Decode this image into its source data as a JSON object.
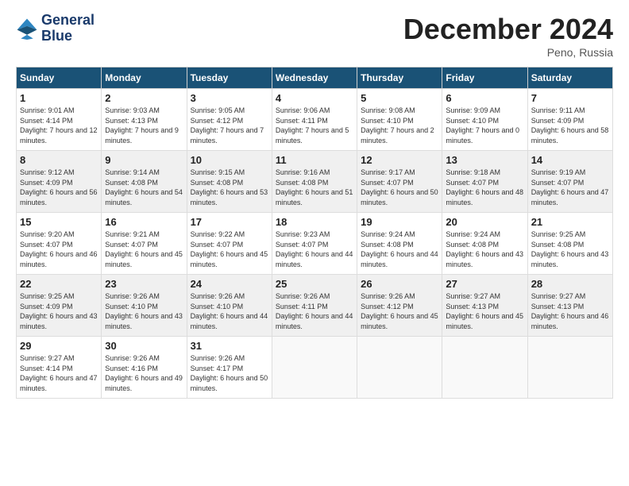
{
  "header": {
    "logo_line1": "General",
    "logo_line2": "Blue",
    "title": "December 2024",
    "location": "Peno, Russia"
  },
  "columns": [
    "Sunday",
    "Monday",
    "Tuesday",
    "Wednesday",
    "Thursday",
    "Friday",
    "Saturday"
  ],
  "weeks": [
    [
      {
        "day": "1",
        "sunrise": "Sunrise: 9:01 AM",
        "sunset": "Sunset: 4:14 PM",
        "daylight": "Daylight: 7 hours and 12 minutes."
      },
      {
        "day": "2",
        "sunrise": "Sunrise: 9:03 AM",
        "sunset": "Sunset: 4:13 PM",
        "daylight": "Daylight: 7 hours and 9 minutes."
      },
      {
        "day": "3",
        "sunrise": "Sunrise: 9:05 AM",
        "sunset": "Sunset: 4:12 PM",
        "daylight": "Daylight: 7 hours and 7 minutes."
      },
      {
        "day": "4",
        "sunrise": "Sunrise: 9:06 AM",
        "sunset": "Sunset: 4:11 PM",
        "daylight": "Daylight: 7 hours and 5 minutes."
      },
      {
        "day": "5",
        "sunrise": "Sunrise: 9:08 AM",
        "sunset": "Sunset: 4:10 PM",
        "daylight": "Daylight: 7 hours and 2 minutes."
      },
      {
        "day": "6",
        "sunrise": "Sunrise: 9:09 AM",
        "sunset": "Sunset: 4:10 PM",
        "daylight": "Daylight: 7 hours and 0 minutes."
      },
      {
        "day": "7",
        "sunrise": "Sunrise: 9:11 AM",
        "sunset": "Sunset: 4:09 PM",
        "daylight": "Daylight: 6 hours and 58 minutes."
      }
    ],
    [
      {
        "day": "8",
        "sunrise": "Sunrise: 9:12 AM",
        "sunset": "Sunset: 4:09 PM",
        "daylight": "Daylight: 6 hours and 56 minutes."
      },
      {
        "day": "9",
        "sunrise": "Sunrise: 9:14 AM",
        "sunset": "Sunset: 4:08 PM",
        "daylight": "Daylight: 6 hours and 54 minutes."
      },
      {
        "day": "10",
        "sunrise": "Sunrise: 9:15 AM",
        "sunset": "Sunset: 4:08 PM",
        "daylight": "Daylight: 6 hours and 53 minutes."
      },
      {
        "day": "11",
        "sunrise": "Sunrise: 9:16 AM",
        "sunset": "Sunset: 4:08 PM",
        "daylight": "Daylight: 6 hours and 51 minutes."
      },
      {
        "day": "12",
        "sunrise": "Sunrise: 9:17 AM",
        "sunset": "Sunset: 4:07 PM",
        "daylight": "Daylight: 6 hours and 50 minutes."
      },
      {
        "day": "13",
        "sunrise": "Sunrise: 9:18 AM",
        "sunset": "Sunset: 4:07 PM",
        "daylight": "Daylight: 6 hours and 48 minutes."
      },
      {
        "day": "14",
        "sunrise": "Sunrise: 9:19 AM",
        "sunset": "Sunset: 4:07 PM",
        "daylight": "Daylight: 6 hours and 47 minutes."
      }
    ],
    [
      {
        "day": "15",
        "sunrise": "Sunrise: 9:20 AM",
        "sunset": "Sunset: 4:07 PM",
        "daylight": "Daylight: 6 hours and 46 minutes."
      },
      {
        "day": "16",
        "sunrise": "Sunrise: 9:21 AM",
        "sunset": "Sunset: 4:07 PM",
        "daylight": "Daylight: 6 hours and 45 minutes."
      },
      {
        "day": "17",
        "sunrise": "Sunrise: 9:22 AM",
        "sunset": "Sunset: 4:07 PM",
        "daylight": "Daylight: 6 hours and 45 minutes."
      },
      {
        "day": "18",
        "sunrise": "Sunrise: 9:23 AM",
        "sunset": "Sunset: 4:07 PM",
        "daylight": "Daylight: 6 hours and 44 minutes."
      },
      {
        "day": "19",
        "sunrise": "Sunrise: 9:24 AM",
        "sunset": "Sunset: 4:08 PM",
        "daylight": "Daylight: 6 hours and 44 minutes."
      },
      {
        "day": "20",
        "sunrise": "Sunrise: 9:24 AM",
        "sunset": "Sunset: 4:08 PM",
        "daylight": "Daylight: 6 hours and 43 minutes."
      },
      {
        "day": "21",
        "sunrise": "Sunrise: 9:25 AM",
        "sunset": "Sunset: 4:08 PM",
        "daylight": "Daylight: 6 hours and 43 minutes."
      }
    ],
    [
      {
        "day": "22",
        "sunrise": "Sunrise: 9:25 AM",
        "sunset": "Sunset: 4:09 PM",
        "daylight": "Daylight: 6 hours and 43 minutes."
      },
      {
        "day": "23",
        "sunrise": "Sunrise: 9:26 AM",
        "sunset": "Sunset: 4:10 PM",
        "daylight": "Daylight: 6 hours and 43 minutes."
      },
      {
        "day": "24",
        "sunrise": "Sunrise: 9:26 AM",
        "sunset": "Sunset: 4:10 PM",
        "daylight": "Daylight: 6 hours and 44 minutes."
      },
      {
        "day": "25",
        "sunrise": "Sunrise: 9:26 AM",
        "sunset": "Sunset: 4:11 PM",
        "daylight": "Daylight: 6 hours and 44 minutes."
      },
      {
        "day": "26",
        "sunrise": "Sunrise: 9:26 AM",
        "sunset": "Sunset: 4:12 PM",
        "daylight": "Daylight: 6 hours and 45 minutes."
      },
      {
        "day": "27",
        "sunrise": "Sunrise: 9:27 AM",
        "sunset": "Sunset: 4:13 PM",
        "daylight": "Daylight: 6 hours and 45 minutes."
      },
      {
        "day": "28",
        "sunrise": "Sunrise: 9:27 AM",
        "sunset": "Sunset: 4:13 PM",
        "daylight": "Daylight: 6 hours and 46 minutes."
      }
    ],
    [
      {
        "day": "29",
        "sunrise": "Sunrise: 9:27 AM",
        "sunset": "Sunset: 4:14 PM",
        "daylight": "Daylight: 6 hours and 47 minutes."
      },
      {
        "day": "30",
        "sunrise": "Sunrise: 9:26 AM",
        "sunset": "Sunset: 4:16 PM",
        "daylight": "Daylight: 6 hours and 49 minutes."
      },
      {
        "day": "31",
        "sunrise": "Sunrise: 9:26 AM",
        "sunset": "Sunset: 4:17 PM",
        "daylight": "Daylight: 6 hours and 50 minutes."
      },
      null,
      null,
      null,
      null
    ]
  ]
}
